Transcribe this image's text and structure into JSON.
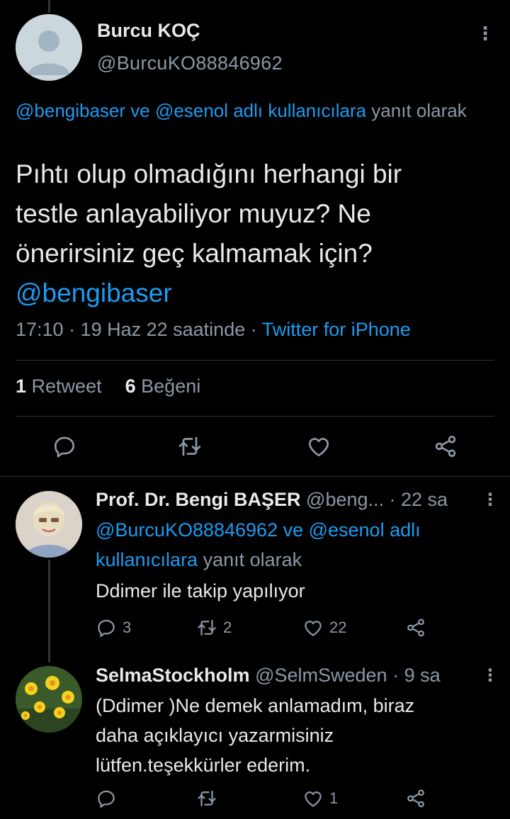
{
  "main_tweet": {
    "name": "Burcu KOÇ",
    "handle": "@BurcuKO88846962",
    "reply_context_prefix": "@bengibaser ve @esenol adlı kullanıcılara",
    "reply_context_suffix": " yanıt olarak",
    "text_line1": "Pıhtı olup olmadığını herhangi bir",
    "text_line2": "testle anlayabiliyor muyuz? Ne",
    "text_line3": "önerirsiniz geç kalmamak için?",
    "text_mention": "@bengibaser",
    "time": "17:10 · 19 Haz 22 saatinde · ",
    "source": "Twitter for iPhone",
    "retweet_count": "1",
    "retweet_label": " Retweet",
    "like_count": "6",
    "like_label": " Beğeni",
    "more_icon": "⋮"
  },
  "reply1": {
    "name": "Prof. Dr. Bengi BAŞER",
    "handle": " @beng...",
    "time": " · 22 sa",
    "ctx_line1_link": "@BurcuKO88846962 ve @esenol adlı",
    "ctx_line2_link": "kullanıcılara",
    "ctx_line2_suffix": " yanıt olarak",
    "text": "Ddimer ile takip yapılıyor",
    "replies": "3",
    "retweets": "2",
    "likes": "22",
    "more_icon": "⋮"
  },
  "reply2": {
    "name": "SelmaStockholm",
    "handle": " @SelmSweden",
    "time": " · 9 sa",
    "text_line1": "(Ddimer )Ne demek anlamadım, biraz",
    "text_line2": "daha açıklayıcı yazarmisiniz",
    "text_line3": "lütfen.teşekkürler ederim.",
    "replies": "",
    "retweets": "",
    "likes": "1",
    "more_icon": "⋮"
  },
  "colors": {
    "background": "#000000",
    "text": "#e7e9ea",
    "muted": "#8b98a5",
    "link": "#1d9bf0",
    "divider": "#2f3336"
  },
  "icons": [
    "reply-icon",
    "retweet-icon",
    "like-icon",
    "share-icon",
    "more-icon"
  ]
}
